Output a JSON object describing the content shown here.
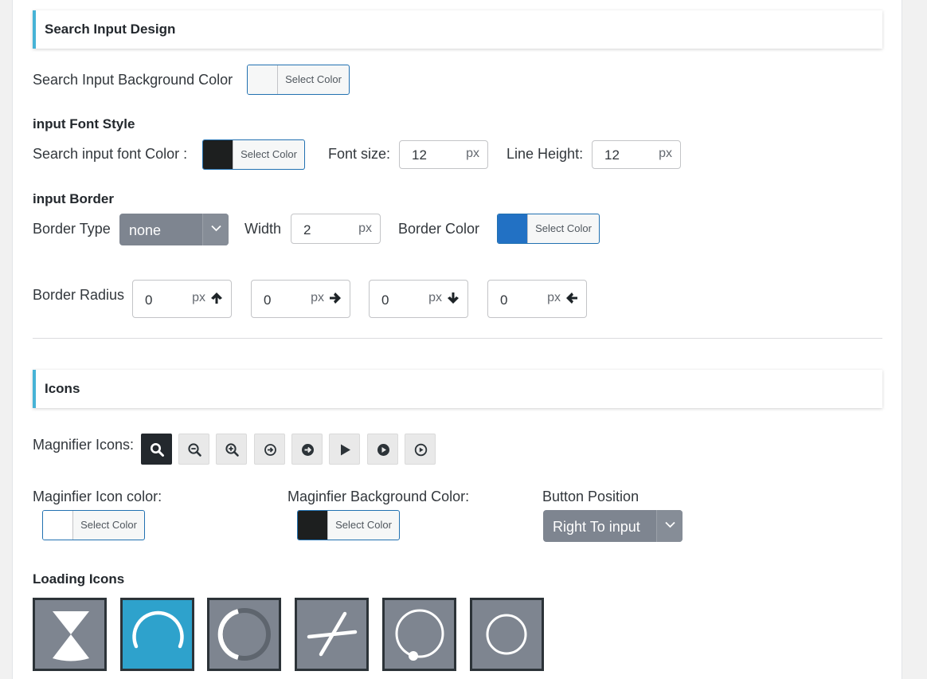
{
  "search_section": {
    "title": "Search Input Design",
    "bg_color_label": "Search Input Background Color",
    "bg_color_button": "Select Color",
    "bg_color_value": "#f6f7f7",
    "font_style_heading": "input Font Style",
    "font_color_label": "Search input font Color :",
    "font_color_button": "Select Color",
    "font_color_value": "#1d1f1f",
    "font_size_label": "Font size:",
    "font_size_value": "12",
    "font_size_unit": "px",
    "line_height_label": "Line Height:",
    "line_height_value": "12",
    "line_height_unit": "px",
    "border_heading": "input Border",
    "border_type_label": "Border Type",
    "border_type_value": "none",
    "width_label": "Width",
    "width_value": "2",
    "width_unit": "px",
    "border_color_label": "Border Color",
    "border_color_button": "Select Color",
    "border_color_value": "#2271c4",
    "radius_label": "Border Radius",
    "radius": [
      {
        "value": "0",
        "unit": "px",
        "icon": "arrow-up-icon"
      },
      {
        "value": "0",
        "unit": "px",
        "icon": "arrow-right-icon"
      },
      {
        "value": "0",
        "unit": "px",
        "icon": "arrow-down-icon"
      },
      {
        "value": "0",
        "unit": "px",
        "icon": "arrow-left-icon"
      }
    ]
  },
  "icons_section": {
    "title": "Icons",
    "magnifier_label": "Magnifier Icons:",
    "magnifier_icons": [
      "search-icon",
      "zoom-out-icon",
      "zoom-in-icon",
      "circle-arrow-small-icon",
      "circle-arrow-icon",
      "play-icon",
      "circle-play-icon",
      "circle-play-outline-icon"
    ],
    "selected_magnifier": 0,
    "icon_color_label": "Maginfier Icon color:",
    "icon_color_button": "Select Color",
    "icon_color_value": "#ffffff",
    "bg_color_label": "Maginfier Background Color:",
    "bg_color_button": "Select Color",
    "bg_color_value": "#1d1f1f",
    "position_label": "Button Position",
    "position_value": "Right To input",
    "loading_heading": "Loading Icons",
    "loading_icons": [
      "hourglass-icon",
      "arc-spinner-icon",
      "ring-spinner-icon",
      "cross-spinner-icon",
      "dot-ring-spinner-icon",
      "circle-icon"
    ],
    "selected_loading": 1
  },
  "colors": {
    "accent": "#46b3d6",
    "select_bg": "#7e8590",
    "active_loading": "#2ea2cc"
  }
}
